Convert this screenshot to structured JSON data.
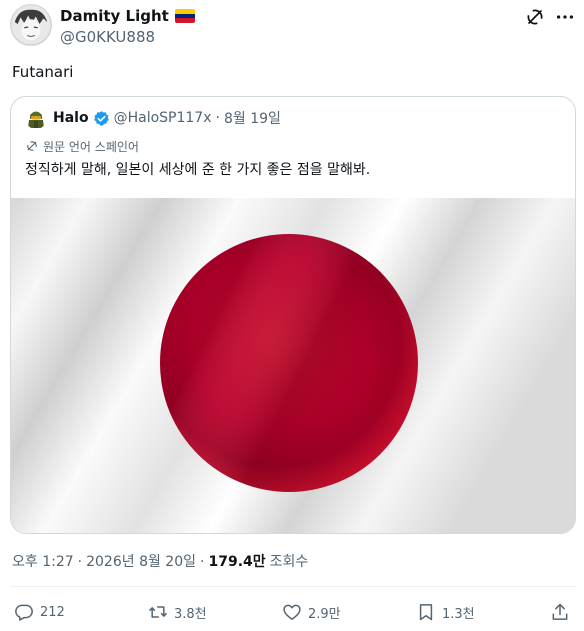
{
  "author": {
    "display_name": "Damity Light",
    "handle": "@G0KKU888",
    "flag": "venezuela-flag"
  },
  "tweet": {
    "text": "Futanari"
  },
  "quoted": {
    "display_name": "Halo",
    "handle": "@HaloSP117x",
    "dot": "·",
    "date": "8월 19일",
    "language_note": "원문 언어 스페인어",
    "text": "정직하게 말해, 일본이 세상에 준 한 가지 좋은 점을 말해봐.",
    "image": "japan-flag"
  },
  "meta": {
    "time": "오후 1:27",
    "dot": "·",
    "date": "2026년 8월 20일",
    "dot2": "·",
    "views_count": "179.4만",
    "views_label": "조회수"
  },
  "actions": {
    "reply_count": "212",
    "repost_count": "3.8천",
    "like_count": "2.9만",
    "bookmark_count": "1.3천"
  },
  "colors": {
    "text_primary": "#0f1419",
    "text_secondary": "#536471",
    "border": "#cfd9de",
    "verified": "#1d9bf0",
    "flag_red": "#bc002d"
  },
  "icons": [
    "grok-icon",
    "more-icon",
    "verified-icon",
    "translate-icon",
    "reply-icon",
    "repost-icon",
    "like-icon",
    "bookmark-icon",
    "share-icon"
  ]
}
